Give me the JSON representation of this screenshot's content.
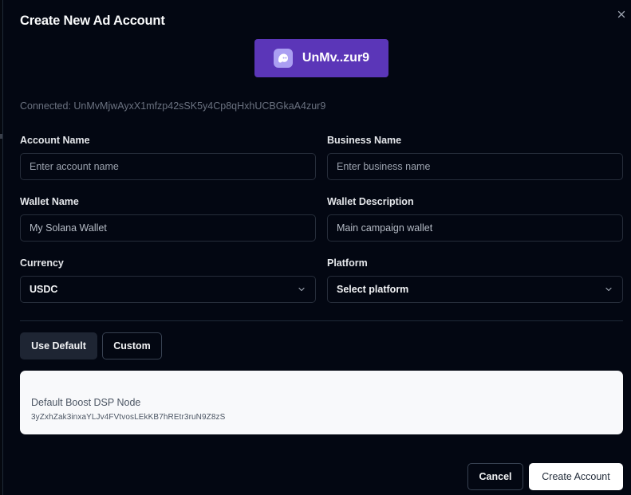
{
  "dialog": {
    "title": "Create New Ad Account",
    "close_label": "×"
  },
  "wallet": {
    "button_label": "UnMv..zur9",
    "icon": "ghost-icon",
    "connected_text": "Connected: UnMvMjwAyxX1mfzp42sSK5y4Cp8qHxhUCBGkaA4zur9"
  },
  "form": {
    "account_name": {
      "label": "Account Name",
      "placeholder": "Enter account name",
      "value": ""
    },
    "business_name": {
      "label": "Business Name",
      "placeholder": "Enter business name",
      "value": ""
    },
    "wallet_name": {
      "label": "Wallet Name",
      "value": "My Solana Wallet"
    },
    "wallet_description": {
      "label": "Wallet Description",
      "value": "Main campaign wallet"
    },
    "currency": {
      "label": "Currency",
      "selected": "USDC"
    },
    "platform": {
      "label": "Platform",
      "selected": "Select platform"
    }
  },
  "node_toggle": {
    "default_label": "Use Default",
    "custom_label": "Custom",
    "active": "default"
  },
  "node": {
    "title": "Default Boost DSP Node",
    "address": "3yZxhZak3inxaYLJv4FVtvosLEkKB7hREtr3ruN9Z8zS"
  },
  "footer": {
    "cancel_label": "Cancel",
    "create_label": "Create Account"
  },
  "colors": {
    "background": "#030712",
    "wallet_button": "#5b36b8",
    "wallet_icon": "#ab9ff2",
    "input_border": "#262d3a",
    "card": "#f8f9fb"
  }
}
